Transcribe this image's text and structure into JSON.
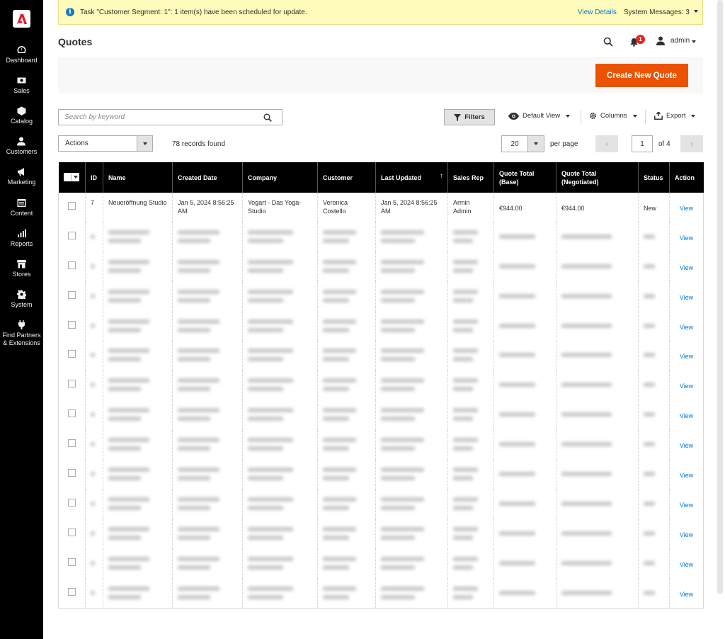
{
  "sidebar": {
    "logo_icon": "adobe-logo-icon",
    "items": [
      {
        "label": "Dashboard",
        "icon": "dashboard-icon"
      },
      {
        "label": "Sales",
        "icon": "dollar-icon"
      },
      {
        "label": "Catalog",
        "icon": "box-icon"
      },
      {
        "label": "Customers",
        "icon": "people-icon"
      },
      {
        "label": "Marketing",
        "icon": "megaphone-icon"
      },
      {
        "label": "Content",
        "icon": "layout-icon"
      },
      {
        "label": "Reports",
        "icon": "bar-chart-icon"
      },
      {
        "label": "Stores",
        "icon": "store-icon"
      },
      {
        "label": "System",
        "icon": "gear-icon"
      },
      {
        "label": "Find Partners & Extensions",
        "icon": "plug-icon"
      }
    ]
  },
  "notice": {
    "message": "Task \"Customer Segment: 1\": 1 item(s) have been scheduled for update.",
    "view_details": "View Details",
    "system_messages": "System Messages: 3"
  },
  "header": {
    "title": "Quotes",
    "notification_count": "1",
    "user": "admin"
  },
  "action_bar": {
    "create_label": "Create New Quote"
  },
  "toolbar": {
    "search_placeholder": "Search by keyword",
    "filters_label": "Filters",
    "view_label": "Default View",
    "columns_label": "Columns",
    "export_label": "Export",
    "actions_label": "Actions",
    "records_found": "78 records found",
    "per_page_value": "20",
    "per_page_label": "per page",
    "page_current": "1",
    "page_total": "of 4"
  },
  "colors": {
    "accent": "#eb5202",
    "link": "#007bdb",
    "header_bg": "#000000",
    "notice_bg": "#fffbbb"
  },
  "table": {
    "columns": [
      "ID",
      "Name",
      "Created Date",
      "Company",
      "Customer",
      "Last Updated",
      "Sales Rep",
      "Quote Total (Base)",
      "Quote Total (Negotiated)",
      "Status",
      "Action"
    ],
    "column_lines": {
      "quote_total_base": [
        "Quote Total",
        "(Base)"
      ],
      "quote_total_negotiated": [
        "Quote Total",
        "(Negotiated)"
      ]
    },
    "first_row": {
      "id": "7",
      "name": "Neueröffnung Studio",
      "created": "Jan 5, 2024 8:56:25 AM",
      "company": "Yogart - Das Yoga-Studio",
      "customer": "Veronica Costello",
      "updated": "Jan 5, 2024 8:56:25 AM",
      "sales_rep": "Armin Admin",
      "total_base": "€944.00",
      "total_negotiated": "€944.00",
      "status": "New",
      "action": "View"
    },
    "view_label": "View"
  }
}
